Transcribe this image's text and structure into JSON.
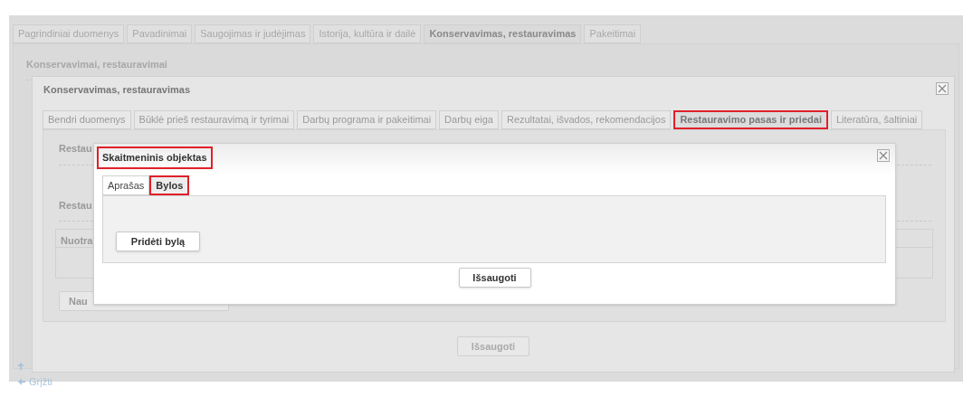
{
  "page": {
    "tabs": [
      {
        "label": "Pagrindiniai duomenys",
        "selected": false
      },
      {
        "label": "Pavadinimai",
        "selected": false
      },
      {
        "label": "Saugojimas ir judėjimas",
        "selected": false
      },
      {
        "label": "Istorija, kultūra ir dailė",
        "selected": false
      },
      {
        "label": "Konservavimas, restauravimas",
        "selected": true
      },
      {
        "label": "Pakeitimai",
        "selected": false
      }
    ],
    "section_title": "Konservavimai, restauravimai",
    "back_link": "Grįžti"
  },
  "dialog": {
    "title": "Konservavimas, restauravimas",
    "tabs": [
      {
        "label": "Bendri duomenys",
        "selected": false,
        "highlighted": false
      },
      {
        "label": "Būklė prieš restauravimą ir tyrimai",
        "selected": false,
        "highlighted": false
      },
      {
        "label": "Darbų programa ir pakeitimai",
        "selected": false,
        "highlighted": false
      },
      {
        "label": "Darbų eiga",
        "selected": false,
        "highlighted": false
      },
      {
        "label": "Rezultatai, išvados, rekomendacijos",
        "selected": false,
        "highlighted": false
      },
      {
        "label": "Restauravimo pasas ir priedai",
        "selected": true,
        "highlighted": true
      },
      {
        "label": "Literatūra, šaltiniai",
        "selected": false,
        "highlighted": false
      }
    ],
    "section_labels": [
      "Restau",
      "Restau"
    ],
    "table_column": "Nuotra",
    "new_button": "Nau",
    "save_button": "Išsaugoti"
  },
  "inner_dialog": {
    "title": "Skaitmeninis objektas",
    "title_highlighted": true,
    "tabs": [
      {
        "label": "Aprašas",
        "selected": false,
        "highlighted": false
      },
      {
        "label": "Bylos",
        "selected": true,
        "highlighted": true
      }
    ],
    "add_button": "Pridėti bylą",
    "save_button": "Išsaugoti"
  }
}
